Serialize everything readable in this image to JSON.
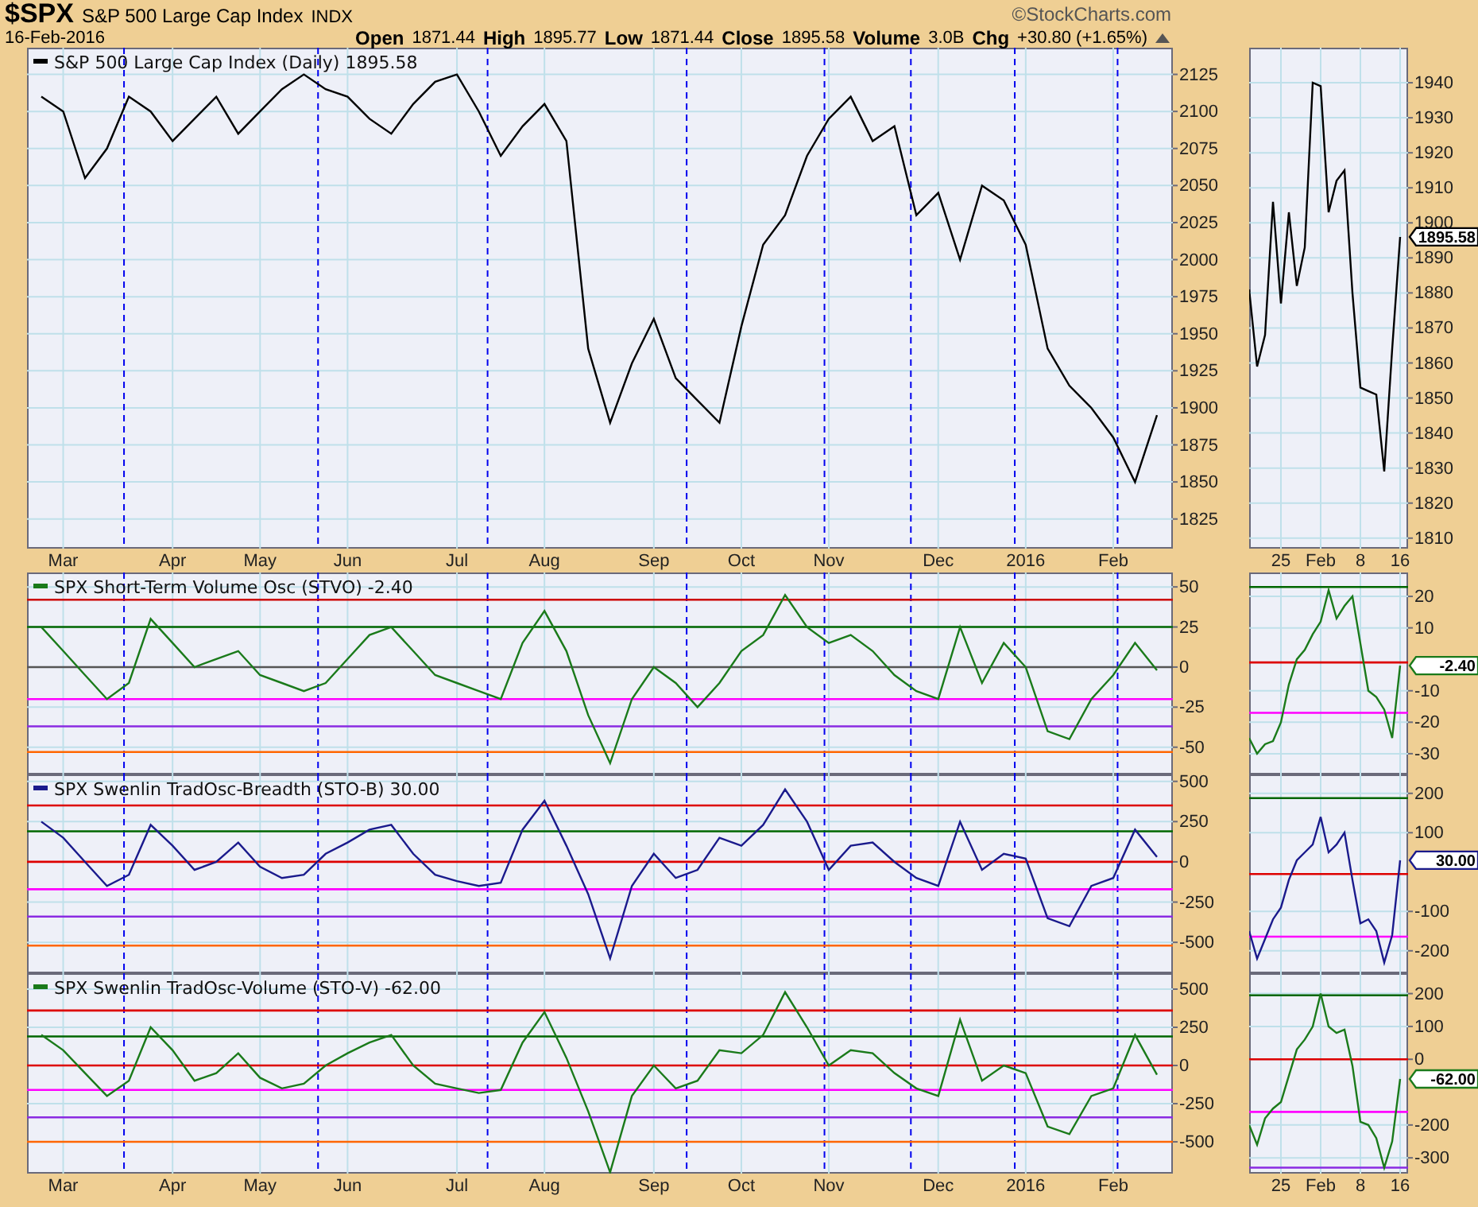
{
  "header": {
    "symbol": "$SPX",
    "name": "S&P 500 Large Cap Index",
    "exchange": "INDX",
    "date": "16-Feb-2016",
    "copyright": "©StockCharts.com",
    "quote": [
      {
        "label": "Open",
        "value": "1871.44"
      },
      {
        "label": "High",
        "value": "1895.77"
      },
      {
        "label": "Low",
        "value": "1871.44"
      },
      {
        "label": "Close",
        "value": "1895.58"
      },
      {
        "label": "Volume",
        "value": "3.0B"
      },
      {
        "label": "Chg",
        "value": "+30.80 (+1.65%)"
      }
    ]
  },
  "charts": [
    {
      "chart_data": {
        "type": "line",
        "title": "S&P 500 Large Cap Index (Daily) 1895.58",
        "ylim": [
          1805,
          2143
        ],
        "grid": true,
        "categories": [
          null,
          "Mar",
          null,
          null,
          null,
          null,
          "Apr",
          null,
          null,
          null,
          "May",
          null,
          null,
          null,
          "Jun",
          null,
          null,
          null,
          null,
          "Jul",
          null,
          null,
          null,
          "Aug",
          null,
          null,
          null,
          null,
          "Sep",
          null,
          null,
          null,
          "Oct",
          null,
          null,
          null,
          "Nov",
          null,
          null,
          null,
          null,
          "Dec",
          null,
          null,
          null,
          "2016",
          null,
          null,
          null,
          "Feb",
          null,
          null
        ],
        "yticks": [
          1825,
          1850,
          1875,
          1900,
          1925,
          1950,
          1975,
          2000,
          2025,
          2050,
          2075,
          2100,
          2125
        ],
        "series": [
          {
            "color": "#000000",
            "values": [
              2110,
              2100,
              2055,
              2075,
              2110,
              2100,
              2080,
              2095,
              2110,
              2085,
              2100,
              2115,
              2125,
              2115,
              2110,
              2095,
              2085,
              2105,
              2120,
              2125,
              2100,
              2070,
              2090,
              2105,
              2080,
              1940,
              1890,
              1930,
              1960,
              1920,
              1905,
              1890,
              1955,
              2010,
              2030,
              2070,
              2095,
              2110,
              2080,
              2090,
              2030,
              2045,
              2000,
              2050,
              2040,
              2010,
              1940,
              1915,
              1900,
              1880,
              1850,
              1895
            ]
          }
        ]
      }
    },
    {
      "chart_data": {
        "type": "line",
        "title": "SPX Short-Term Volume Osc (STVO) -2.40",
        "ylim": [
          -67,
          59
        ],
        "grid": true,
        "categories": [
          null,
          null,
          null,
          null,
          null,
          null,
          null,
          null,
          null,
          null,
          null,
          null,
          null,
          null,
          null,
          null,
          null,
          null,
          null,
          null,
          null,
          null,
          null,
          null,
          null,
          null,
          null,
          null,
          null,
          null,
          null,
          null,
          null,
          null,
          null,
          null,
          null,
          null,
          null,
          null,
          null,
          null,
          null,
          null,
          null,
          null,
          null,
          null,
          null,
          null,
          null,
          null
        ],
        "yticks": [
          -50,
          -25,
          0,
          25,
          50
        ],
        "series": [
          {
            "color": "#1a7a1a",
            "values": [
              25,
              10,
              -5,
              -20,
              -10,
              30,
              15,
              0,
              5,
              10,
              -5,
              -10,
              -15,
              -10,
              5,
              20,
              25,
              10,
              -5,
              -10,
              -15,
              -20,
              15,
              35,
              10,
              -30,
              -60,
              -20,
              0,
              -10,
              -25,
              -10,
              10,
              20,
              45,
              25,
              15,
              20,
              10,
              -5,
              -15,
              -20,
              25,
              -10,
              15,
              0,
              -40,
              -45,
              -20,
              -5,
              15,
              -2
            ]
          }
        ],
        "ref_lines": [
          {
            "axis": "y",
            "value": 42,
            "color": "#cc0000"
          },
          {
            "axis": "y",
            "value": 25,
            "color": "#006600"
          },
          {
            "axis": "y",
            "value": 0,
            "color": "#555555"
          },
          {
            "axis": "y",
            "value": -20,
            "color": "#ff00ff"
          },
          {
            "axis": "y",
            "value": -37,
            "color": "#8a2be2"
          },
          {
            "axis": "y",
            "value": -53,
            "color": "#ff6600"
          }
        ]
      }
    },
    {
      "chart_data": {
        "type": "line",
        "title": "SPX Swenlin TradOsc-Breadth (STO-B) 30.00",
        "ylim": [
          -692,
          543
        ],
        "grid": true,
        "categories": [
          null,
          null,
          null,
          null,
          null,
          null,
          null,
          null,
          null,
          null,
          null,
          null,
          null,
          null,
          null,
          null,
          null,
          null,
          null,
          null,
          null,
          null,
          null,
          null,
          null,
          null,
          null,
          null,
          null,
          null,
          null,
          null,
          null,
          null,
          null,
          null,
          null,
          null,
          null,
          null,
          null,
          null,
          null,
          null,
          null,
          null,
          null,
          null,
          null,
          null,
          null,
          null
        ],
        "yticks": [
          -500,
          -250,
          0,
          250,
          500
        ],
        "series": [
          {
            "color": "#1a1a8c",
            "values": [
              250,
              150,
              0,
              -150,
              -80,
              230,
              100,
              -50,
              0,
              120,
              -30,
              -100,
              -80,
              50,
              120,
              200,
              230,
              50,
              -80,
              -120,
              -150,
              -130,
              200,
              380,
              100,
              -200,
              -600,
              -150,
              50,
              -100,
              -50,
              150,
              100,
              230,
              450,
              250,
              -50,
              100,
              120,
              0,
              -100,
              -150,
              250,
              -50,
              50,
              20,
              -350,
              -400,
              -150,
              -100,
              200,
              30
            ]
          }
        ],
        "ref_lines": [
          {
            "axis": "y",
            "value": 350,
            "color": "#dd0000"
          },
          {
            "axis": "y",
            "value": 190,
            "color": "#006600"
          },
          {
            "axis": "y",
            "value": 0,
            "color": "#dd0000"
          },
          {
            "axis": "y",
            "value": -170,
            "color": "#ff00ff"
          },
          {
            "axis": "y",
            "value": -340,
            "color": "#8a2be2"
          },
          {
            "axis": "y",
            "value": -520,
            "color": "#ff6600"
          }
        ]
      }
    },
    {
      "chart_data": {
        "type": "line",
        "title": "SPX Swenlin TradOsc-Volume (STO-V) -62.00",
        "ylim": [
          -708,
          604
        ],
        "grid": true,
        "categories": [
          null,
          "Mar",
          null,
          null,
          null,
          null,
          "Apr",
          null,
          null,
          null,
          "May",
          null,
          null,
          null,
          "Jun",
          null,
          null,
          null,
          null,
          "Jul",
          null,
          null,
          null,
          "Aug",
          null,
          null,
          null,
          null,
          "Sep",
          null,
          null,
          null,
          "Oct",
          null,
          null,
          null,
          "Nov",
          null,
          null,
          null,
          null,
          "Dec",
          null,
          null,
          null,
          "2016",
          null,
          null,
          null,
          "Feb",
          null,
          null
        ],
        "yticks": [
          -500,
          -250,
          0,
          250,
          500
        ],
        "series": [
          {
            "color": "#1a7a1a",
            "values": [
              200,
              100,
              -50,
              -200,
              -100,
              250,
              100,
              -100,
              -50,
              80,
              -80,
              -150,
              -120,
              0,
              80,
              150,
              200,
              0,
              -120,
              -150,
              -180,
              -160,
              150,
              350,
              50,
              -300,
              -700,
              -200,
              0,
              -150,
              -100,
              100,
              80,
              200,
              480,
              250,
              0,
              100,
              80,
              -50,
              -150,
              -200,
              300,
              -100,
              0,
              -50,
              -400,
              -450,
              -200,
              -150,
              200,
              -60
            ]
          }
        ],
        "ref_lines": [
          {
            "axis": "y",
            "value": 360,
            "color": "#dd0000"
          },
          {
            "axis": "y",
            "value": 190,
            "color": "#006600"
          },
          {
            "axis": "y",
            "value": 0,
            "color": "#dd0000"
          },
          {
            "axis": "y",
            "value": -160,
            "color": "#ff00ff"
          },
          {
            "axis": "y",
            "value": -340,
            "color": "#8a2be2"
          },
          {
            "axis": "y",
            "value": -500,
            "color": "#ff6600"
          }
        ]
      }
    },
    {
      "chart_data": {
        "type": "line",
        "ylim": [
          1807,
          1950
        ],
        "grid": true,
        "categories": [
          null,
          null,
          null,
          null,
          "25",
          null,
          null,
          null,
          null,
          "Feb",
          null,
          null,
          null,
          null,
          "8",
          null,
          null,
          null,
          null,
          "16"
        ],
        "yticks": [
          1810,
          1820,
          1830,
          1840,
          1850,
          1860,
          1870,
          1880,
          1890,
          1900,
          1910,
          1920,
          1930,
          1940
        ],
        "series": [
          {
            "color": "#000000",
            "values": [
              1881,
              1859,
              1868,
              1906,
              1877,
              1903,
              1882,
              1893,
              1940,
              1939,
              1903,
              1912,
              1915,
              1880,
              1853,
              1852,
              1851,
              1829,
              1864,
              1896
            ]
          }
        ],
        "annotations": [
          "1895.58"
        ]
      }
    },
    {
      "chart_data": {
        "type": "line",
        "ylim": [
          -36.6,
          27.6
        ],
        "grid": true,
        "categories": [
          null,
          null,
          null,
          null,
          null,
          null,
          null,
          null,
          null,
          null,
          null,
          null,
          null,
          null,
          null,
          null,
          null,
          null,
          null,
          null
        ],
        "yticks": [
          -30,
          -20,
          -10,
          10,
          20
        ],
        "series": [
          {
            "color": "#1a7a1a",
            "values": [
              -25,
              -30,
              -27,
              -26,
              -20,
              -8,
              0,
              3,
              8,
              12,
              22,
              13,
              17,
              20,
              5,
              -10,
              -12,
              -16,
              -25,
              -2
            ]
          }
        ],
        "ref_lines": [
          {
            "axis": "y",
            "value": 23,
            "color": "#006600"
          },
          {
            "axis": "y",
            "value": -1,
            "color": "#dd0000"
          },
          {
            "axis": "y",
            "value": -17,
            "color": "#ff00ff"
          }
        ],
        "annotations": [
          "-2.40"
        ]
      }
    },
    {
      "chart_data": {
        "type": "line",
        "ylim": [
          -257,
          248
        ],
        "grid": true,
        "categories": [
          null,
          null,
          null,
          null,
          null,
          null,
          null,
          null,
          null,
          null,
          null,
          null,
          null,
          null,
          null,
          null,
          null,
          null,
          null,
          null
        ],
        "yticks": [
          -200,
          -100,
          100,
          200
        ],
        "series": [
          {
            "color": "#1a1a8c",
            "values": [
              -150,
              -220,
              -170,
              -120,
              -90,
              -20,
              30,
              50,
              70,
              140,
              50,
              70,
              100,
              -20,
              -130,
              -120,
              -150,
              -230,
              -160,
              30
            ]
          }
        ],
        "ref_lines": [
          {
            "axis": "y",
            "value": 188,
            "color": "#006600"
          },
          {
            "axis": "y",
            "value": -5,
            "color": "#dd0000"
          },
          {
            "axis": "y",
            "value": -164,
            "color": "#ff00ff"
          }
        ],
        "annotations": [
          "30.00"
        ]
      }
    },
    {
      "chart_data": {
        "type": "line",
        "ylim": [
          -348,
          262
        ],
        "grid": true,
        "categories": [
          null,
          null,
          null,
          null,
          "25",
          null,
          null,
          null,
          null,
          "Feb",
          null,
          null,
          null,
          null,
          "8",
          null,
          null,
          null,
          null,
          "16"
        ],
        "yticks": [
          -300,
          -200,
          0,
          100,
          200
        ],
        "series": [
          {
            "color": "#1a7a1a",
            "values": [
              -200,
              -260,
              -180,
              -150,
              -130,
              -50,
              30,
              60,
              100,
              200,
              100,
              80,
              90,
              -20,
              -190,
              -200,
              -240,
              -330,
              -250,
              -60
            ]
          }
        ],
        "ref_lines": [
          {
            "axis": "y",
            "value": 195,
            "color": "#006600"
          },
          {
            "axis": "y",
            "value": 0,
            "color": "#dd0000"
          },
          {
            "axis": "y",
            "value": -160,
            "color": "#ff00ff"
          },
          {
            "axis": "y",
            "value": -330,
            "color": "#8a2be2"
          }
        ],
        "annotations": [
          "-62.00"
        ]
      }
    }
  ]
}
